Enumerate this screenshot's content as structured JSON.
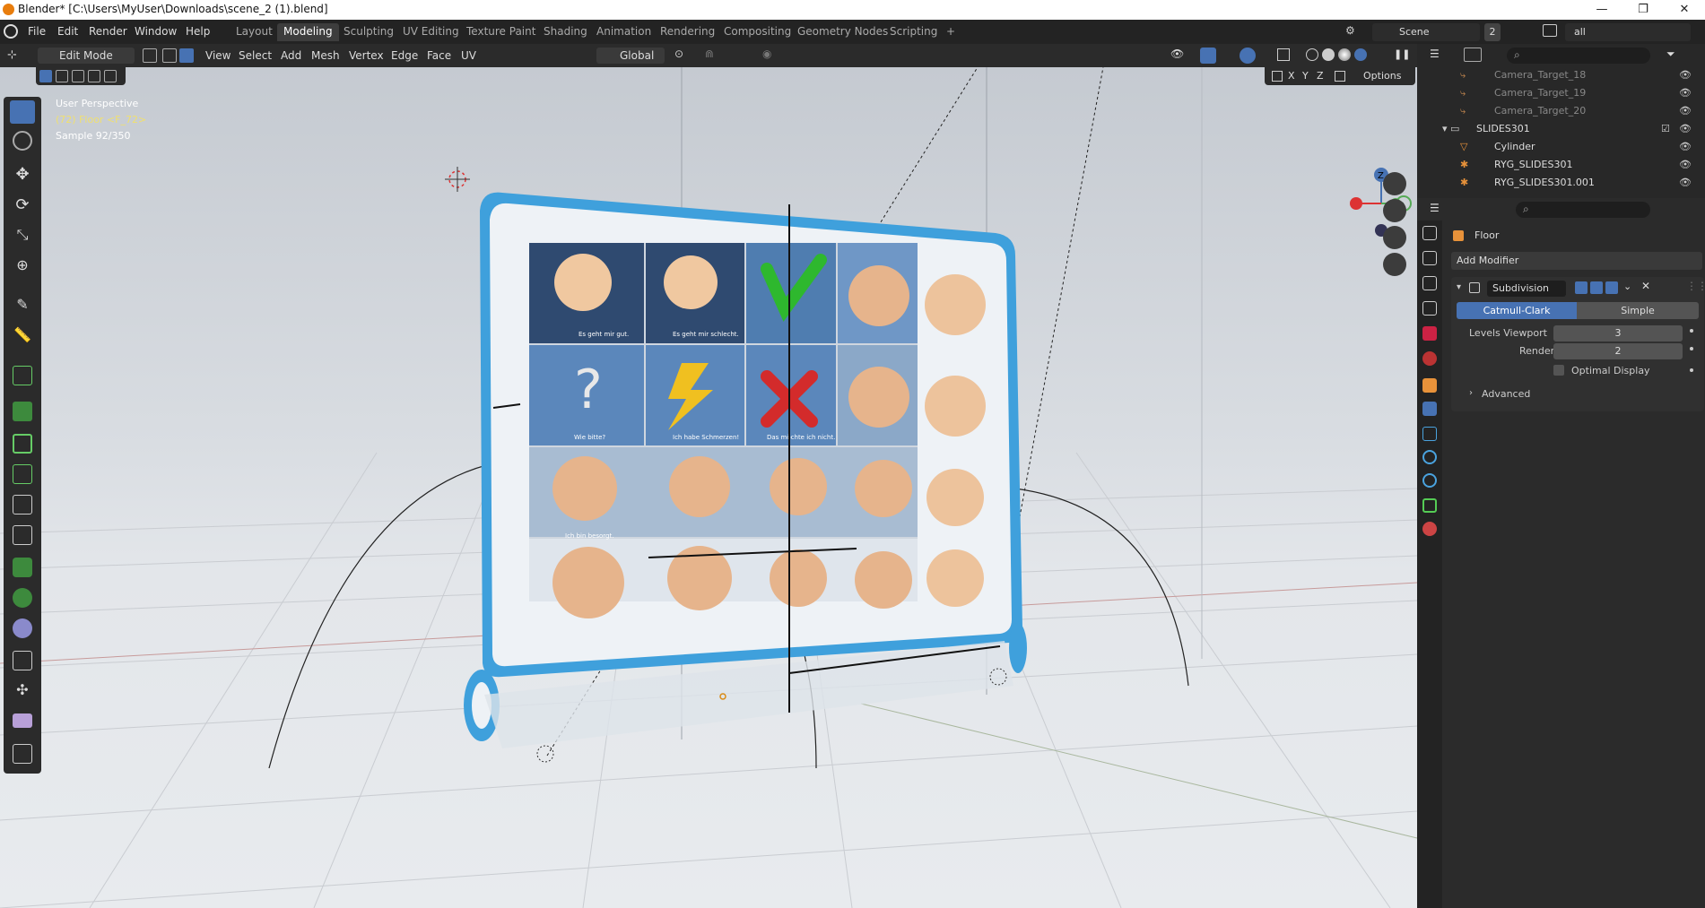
{
  "window": {
    "title": "Blender* [C:\\Users\\MyUser\\Downloads\\scene_2 (1).blend]",
    "controls": [
      "—",
      "❐",
      "✕"
    ]
  },
  "menus": [
    "File",
    "Edit",
    "Render",
    "Window",
    "Help"
  ],
  "workspaces": [
    "Layout",
    "Modeling",
    "Sculpting",
    "UV Editing",
    "Texture Paint",
    "Shading",
    "Animation",
    "Rendering",
    "Compositing",
    "Geometry Nodes",
    "Scripting",
    "+"
  ],
  "active_workspace": "Modeling",
  "scene": {
    "name": "Scene",
    "users": "2"
  },
  "view_layer": "all",
  "header": {
    "mode": "Edit Mode",
    "menus": [
      "View",
      "Select",
      "Add",
      "Mesh",
      "Vertex",
      "Edge",
      "Face",
      "UV"
    ],
    "orientation": "Global",
    "options": "Options",
    "axes": [
      "X",
      "Y",
      "Z"
    ]
  },
  "viewport": {
    "perspective": "User Perspective",
    "object_info": "(72) Floor <F_72>",
    "sample": "Sample 92/350",
    "gizmo_axis_z": "Z"
  },
  "outliner": {
    "rows": [
      {
        "name": "Camera_Target_18",
        "type": "empty",
        "dim": true
      },
      {
        "name": "Camera_Target_19",
        "type": "empty",
        "dim": true
      },
      {
        "name": "Camera_Target_20",
        "type": "empty",
        "dim": true
      },
      {
        "name": "SLIDES301",
        "type": "collection",
        "dim": false
      },
      {
        "name": "Cylinder",
        "type": "mesh",
        "dim": false
      },
      {
        "name": "RYG_SLIDES301",
        "type": "armature",
        "dim": false
      },
      {
        "name": "RYG_SLIDES301.001",
        "type": "armature",
        "dim": false
      }
    ]
  },
  "properties": {
    "object_name": "Floor",
    "add_modifier": "Add Modifier",
    "modifier": {
      "name": "Subdivision",
      "types": [
        "Catmull-Clark",
        "Simple"
      ],
      "active_type": "Catmull-Clark",
      "levels_viewport_label": "Levels Viewport",
      "levels_viewport": "3",
      "render_label": "Render",
      "render": "2",
      "optimal_display": "Optimal Display",
      "advanced": "Advanced"
    }
  },
  "tablet_captions": [
    "Es geht mir gut.",
    "Es geht mir schlecht.",
    "Wie bitte?",
    "Ich habe Schmerzen!",
    "Das möchte ich nicht.",
    "Ich bin besorgt."
  ],
  "colors": {
    "accent": "#4772b3",
    "ui_bg": "#2b2b2b",
    "tablet_blue": "#3fa0dc"
  }
}
